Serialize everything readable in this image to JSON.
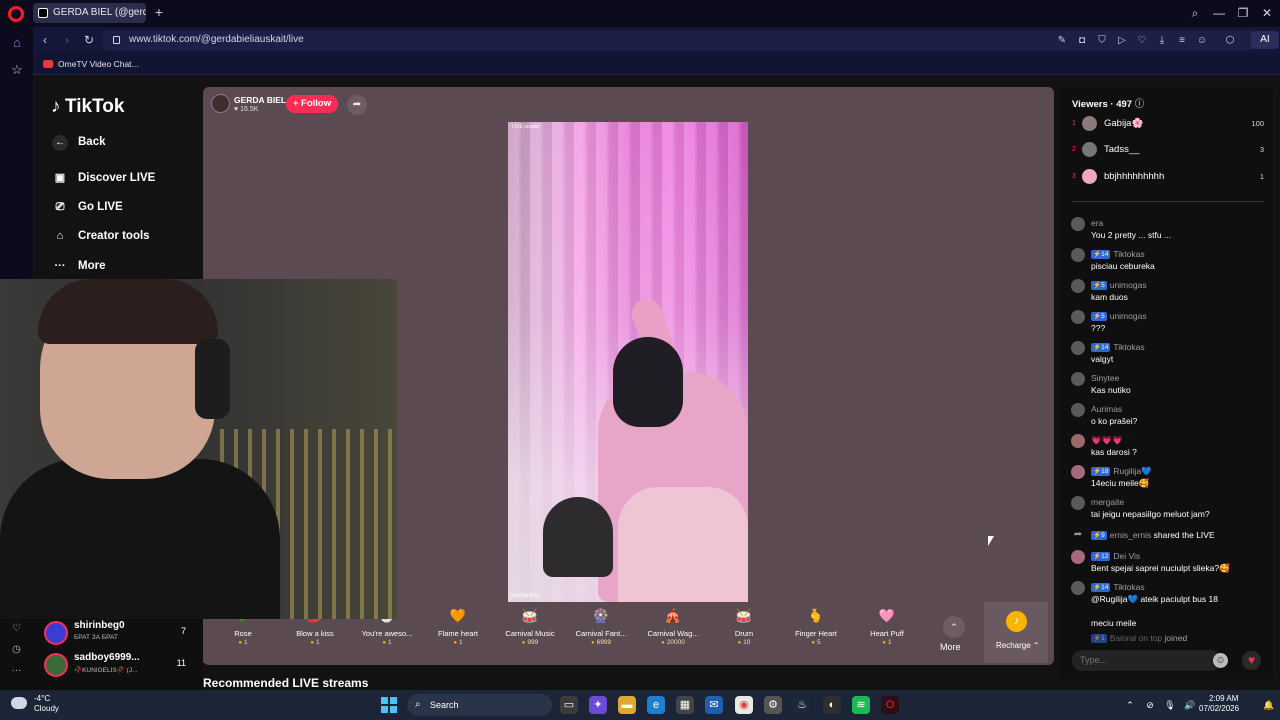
{
  "browser": {
    "tab_title": "GERDA BIEL (@gerdabielia",
    "url": "www.tiktok.com/@gerdabieliauskait/live",
    "bookmark": "OmeTV Video Chat...",
    "ai_label": "AI"
  },
  "tiktok": {
    "logo": "TikTok",
    "nav": {
      "back": "Back",
      "discover": "Discover LIVE",
      "go_live": "Go LIVE",
      "creator_tools": "Creator tools",
      "more": "More"
    },
    "host": {
      "name": "GERDA BIEL",
      "likes": "16.5K",
      "follow_label": "+ Follow"
    },
    "video": {
      "live_creator": "LIVE creator",
      "footer": "GERDA BIEL"
    },
    "gifts": [
      {
        "name": "Rose",
        "price": "1",
        "icon": "🌹",
        "color": "#ff4d6d"
      },
      {
        "name": "Blow a kiss",
        "price": "1",
        "icon": "💋",
        "color": "#ff3050"
      },
      {
        "name": "You're aweso...",
        "price": "1",
        "icon": "🐣",
        "color": "#d9c9a0"
      },
      {
        "name": "Flame heart",
        "price": "1",
        "icon": "🧡",
        "color": "#ff6a3d"
      },
      {
        "name": "Carnival Music",
        "price": "999",
        "icon": "🥁",
        "color": "#8ad06a"
      },
      {
        "name": "Carnival Fant...",
        "price": "6999",
        "icon": "🎡",
        "color": "#f7a34b"
      },
      {
        "name": "Carnival Wag...",
        "price": "20000",
        "icon": "🎪",
        "color": "#c88bd6"
      },
      {
        "name": "Drum",
        "price": "10",
        "icon": "🥁",
        "color": "#c98a4b"
      },
      {
        "name": "Finger Heart",
        "price": "5",
        "icon": "🫰",
        "color": "#f28b6b"
      },
      {
        "name": "Heart Puff",
        "price": "1",
        "icon": "🩷",
        "color": "#f7a8d8"
      }
    ],
    "more_label": "More",
    "recharge_label": "Recharge",
    "recommended_title": "Recommended LIVE streams",
    "viewers": {
      "title": "Viewers",
      "count": "497",
      "top": [
        {
          "rank": "1",
          "name": "Gabija🌸",
          "score": "100"
        },
        {
          "rank": "2",
          "name": "Tadss__",
          "score": "3"
        },
        {
          "rank": "3",
          "name": "bbjhhhhhhhhh",
          "score": "1"
        }
      ]
    },
    "chat": [
      {
        "user": "era",
        "level": "",
        "msg": "You 2 pretty ... stfu ..."
      },
      {
        "user": "Tiktokas",
        "level": "14",
        "msg": "pisciau cebureka"
      },
      {
        "user": "unimogas",
        "level": "5",
        "msg": "kam duos"
      },
      {
        "user": "unimogas",
        "level": "5",
        "msg": "???"
      },
      {
        "user": "Tiktokas",
        "level": "14",
        "msg": "valgyt"
      },
      {
        "user": "Sinytee",
        "level": "",
        "msg": "Kas nutiko"
      },
      {
        "user": "Aurimas",
        "level": "",
        "msg": "o ko prašei?"
      },
      {
        "user": "💗💗💗",
        "level": "",
        "msg": "kas darosi ?"
      },
      {
        "user": "Rugilija💙",
        "level": "18",
        "msg": "14eciu meile🥰"
      },
      {
        "user": "mergaite",
        "level": "",
        "msg": "tai jeigu nepasiilgo meluot jam?"
      },
      {
        "user": "ernis_ernis",
        "level": "9",
        "msg": "shared the LIVE"
      },
      {
        "user": "Dei Vis",
        "level": "12",
        "msg": "Bent spejai saprei nuciulpt slieka?🥰"
      },
      {
        "user": "Tiktokas",
        "level": "14",
        "msg": "@Rugilija💙 ateik paciulpt bus 18"
      },
      {
        "user": "",
        "level": "",
        "msg": "meciu meile"
      },
      {
        "user": "Baiorai on top",
        "level": "1",
        "msg": "joined"
      }
    ],
    "chat_placeholder": "Type...",
    "streams": [
      {
        "name": "shirinbeg0",
        "sub": "БРАТ ЗА БРАТ",
        "count": "7"
      },
      {
        "name": "sadboy6999...",
        "sub": "🥀KUNIGELIS🥀 (J...",
        "count": "11"
      }
    ]
  },
  "taskbar": {
    "weather_temp": "-4°C",
    "weather_cond": "Cloudy",
    "search_label": "Search",
    "time": "2:09 AM",
    "date": "07/02/2026"
  }
}
